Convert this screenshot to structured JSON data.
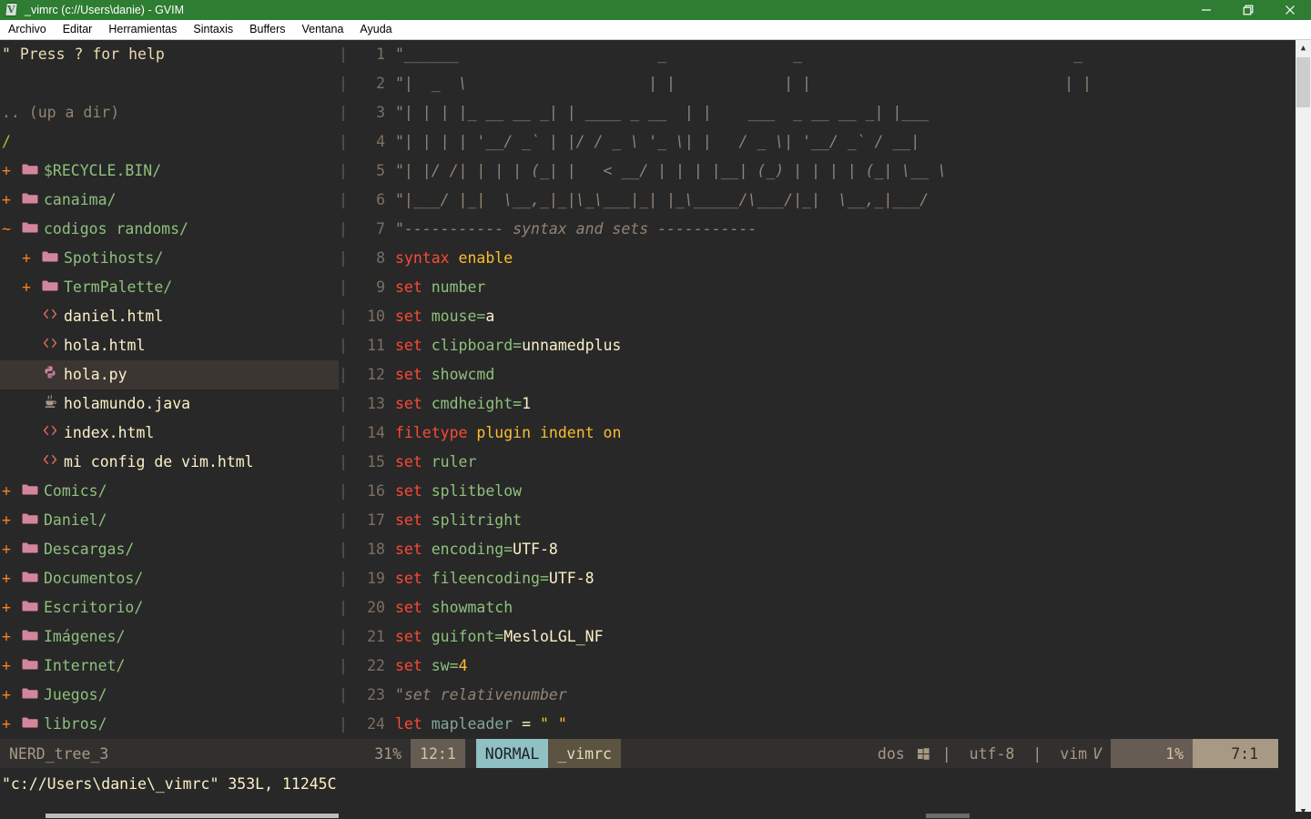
{
  "window": {
    "title": "_vimrc (c://Users\\danie) - GVIM",
    "icon": "gvim-icon",
    "controls": {
      "minimize": "minimize-icon",
      "restore": "restore-icon",
      "close": "close-icon"
    },
    "titlebar_color": "#2e7d32"
  },
  "menubar": {
    "items": [
      {
        "label": "Archivo"
      },
      {
        "label": "Editar"
      },
      {
        "label": "Herramientas"
      },
      {
        "label": "Sintaxis"
      },
      {
        "label": "Buffers"
      },
      {
        "label": "Ventana"
      },
      {
        "label": "Ayuda"
      }
    ]
  },
  "nerdtree": {
    "help_line": "\" Press ? for help",
    "blank_line": "",
    "up_dir": ".. (up a dir)",
    "root": "/",
    "rows": [
      {
        "marker": "+",
        "icon": "folder-icon",
        "kind": "dir",
        "indent": 0,
        "label": "$RECYCLE.BIN/"
      },
      {
        "marker": "+",
        "icon": "folder-icon",
        "kind": "dir",
        "indent": 0,
        "label": "canaima/"
      },
      {
        "marker": "~",
        "icon": "folder-icon",
        "kind": "dir",
        "indent": 0,
        "label": "codigos randoms/"
      },
      {
        "marker": "+",
        "icon": "folder-icon",
        "kind": "dir",
        "indent": 1,
        "label": "Spotihosts/"
      },
      {
        "marker": "+",
        "icon": "folder-icon",
        "kind": "dir",
        "indent": 1,
        "label": "TermPalette/"
      },
      {
        "marker": "",
        "icon": "html-file-icon",
        "kind": "file",
        "indent": 1,
        "label": "daniel.html"
      },
      {
        "marker": "",
        "icon": "html-file-icon",
        "kind": "file",
        "indent": 1,
        "label": "hola.html"
      },
      {
        "marker": "",
        "icon": "python-file-icon",
        "kind": "file",
        "indent": 1,
        "label": "hola.py",
        "selected": true
      },
      {
        "marker": "",
        "icon": "java-file-icon",
        "kind": "file",
        "indent": 1,
        "label": "holamundo.java"
      },
      {
        "marker": "",
        "icon": "html-file-icon",
        "kind": "file",
        "indent": 1,
        "label": "index.html"
      },
      {
        "marker": "",
        "icon": "html-file-icon",
        "kind": "file",
        "indent": 1,
        "label": "mi config de vim.html"
      },
      {
        "marker": "+",
        "icon": "folder-icon",
        "kind": "dir",
        "indent": 0,
        "label": "Comics/"
      },
      {
        "marker": "+",
        "icon": "folder-icon",
        "kind": "dir",
        "indent": 0,
        "label": "Daniel/"
      },
      {
        "marker": "+",
        "icon": "folder-icon",
        "kind": "dir",
        "indent": 0,
        "label": "Descargas/"
      },
      {
        "marker": "+",
        "icon": "folder-icon",
        "kind": "dir",
        "indent": 0,
        "label": "Documentos/"
      },
      {
        "marker": "+",
        "icon": "folder-icon",
        "kind": "dir",
        "indent": 0,
        "label": "Escritorio/"
      },
      {
        "marker": "+",
        "icon": "folder-icon",
        "kind": "dir",
        "indent": 0,
        "label": "Imágenes/"
      },
      {
        "marker": "+",
        "icon": "folder-icon",
        "kind": "dir",
        "indent": 0,
        "label": "Internet/"
      },
      {
        "marker": "+",
        "icon": "folder-icon",
        "kind": "dir",
        "indent": 0,
        "label": "Juegos/"
      },
      {
        "marker": "+",
        "icon": "folder-icon",
        "kind": "dir",
        "indent": 0,
        "label": "libros/"
      }
    ]
  },
  "editor": {
    "lines": [
      {
        "n": 1,
        "tokens": [
          {
            "t": "\"______                      _              _                              _",
            "c": "comment"
          }
        ]
      },
      {
        "n": 2,
        "tokens": [
          {
            "t": "\"|  _  \\                    | |            | |                            | |",
            "c": "comment"
          }
        ]
      },
      {
        "n": 3,
        "tokens": [
          {
            "t": "\"| | | |_ __ __ _| | ____ _ __  | |    ___  _ __ __ _| |___",
            "c": "comment"
          }
        ]
      },
      {
        "n": 4,
        "tokens": [
          {
            "t": "\"| | | | '__/ _` | |/ / _ \\ '_ \\| |   / _ \\| '__/ _` / __|",
            "c": "comment"
          }
        ]
      },
      {
        "n": 5,
        "tokens": [
          {
            "t": "\"| |/ /| | | | (_| |   < __/ | | | |__| (_) | | | | (_| \\__ \\",
            "c": "comment"
          }
        ]
      },
      {
        "n": 6,
        "tokens": [
          {
            "t": "\"|___/ |_|  \\__,_|_|\\_\\___|_| |_\\_____/\\___/|_|  \\__,_|___/",
            "c": "comment"
          }
        ]
      },
      {
        "n": 7,
        "tokens": [
          {
            "t": "\"----------- syntax and sets -----------",
            "c": "comment"
          }
        ]
      },
      {
        "n": 8,
        "tokens": [
          {
            "t": "syntax",
            "c": "cmd"
          },
          {
            "t": " ",
            "c": "op"
          },
          {
            "t": "enable",
            "c": "const"
          }
        ]
      },
      {
        "n": 9,
        "tokens": [
          {
            "t": "set",
            "c": "cmd"
          },
          {
            "t": " ",
            "c": "op"
          },
          {
            "t": "number",
            "c": "opt"
          }
        ]
      },
      {
        "n": 10,
        "tokens": [
          {
            "t": "set",
            "c": "cmd"
          },
          {
            "t": " ",
            "c": "op"
          },
          {
            "t": "mouse=",
            "c": "opt"
          },
          {
            "t": "a",
            "c": "val"
          }
        ]
      },
      {
        "n": 11,
        "tokens": [
          {
            "t": "set",
            "c": "cmd"
          },
          {
            "t": " ",
            "c": "op"
          },
          {
            "t": "clipboard=",
            "c": "opt"
          },
          {
            "t": "unnamedplus",
            "c": "val"
          }
        ]
      },
      {
        "n": 12,
        "tokens": [
          {
            "t": "set",
            "c": "cmd"
          },
          {
            "t": " ",
            "c": "op"
          },
          {
            "t": "showcmd",
            "c": "opt"
          }
        ]
      },
      {
        "n": 13,
        "tokens": [
          {
            "t": "set",
            "c": "cmd"
          },
          {
            "t": " ",
            "c": "op"
          },
          {
            "t": "cmdheight=",
            "c": "opt"
          },
          {
            "t": "1",
            "c": "val"
          }
        ]
      },
      {
        "n": 14,
        "tokens": [
          {
            "t": "filetype",
            "c": "cmd"
          },
          {
            "t": " ",
            "c": "op"
          },
          {
            "t": "plugin",
            "c": "const"
          },
          {
            "t": " ",
            "c": "op"
          },
          {
            "t": "indent",
            "c": "const"
          },
          {
            "t": " ",
            "c": "op"
          },
          {
            "t": "on",
            "c": "const"
          }
        ]
      },
      {
        "n": 15,
        "tokens": [
          {
            "t": "set",
            "c": "cmd"
          },
          {
            "t": " ",
            "c": "op"
          },
          {
            "t": "ruler",
            "c": "opt"
          }
        ]
      },
      {
        "n": 16,
        "tokens": [
          {
            "t": "set",
            "c": "cmd"
          },
          {
            "t": " ",
            "c": "op"
          },
          {
            "t": "splitbelow",
            "c": "opt"
          }
        ]
      },
      {
        "n": 17,
        "tokens": [
          {
            "t": "set",
            "c": "cmd"
          },
          {
            "t": " ",
            "c": "op"
          },
          {
            "t": "splitright",
            "c": "opt"
          }
        ]
      },
      {
        "n": 18,
        "tokens": [
          {
            "t": "set",
            "c": "cmd"
          },
          {
            "t": " ",
            "c": "op"
          },
          {
            "t": "encoding=",
            "c": "opt"
          },
          {
            "t": "UTF-8",
            "c": "val"
          }
        ]
      },
      {
        "n": 19,
        "tokens": [
          {
            "t": "set",
            "c": "cmd"
          },
          {
            "t": " ",
            "c": "op"
          },
          {
            "t": "fileencoding=",
            "c": "opt"
          },
          {
            "t": "UTF-8",
            "c": "val"
          }
        ]
      },
      {
        "n": 20,
        "tokens": [
          {
            "t": "set",
            "c": "cmd"
          },
          {
            "t": " ",
            "c": "op"
          },
          {
            "t": "showmatch",
            "c": "opt"
          }
        ]
      },
      {
        "n": 21,
        "tokens": [
          {
            "t": "set",
            "c": "cmd"
          },
          {
            "t": " ",
            "c": "op"
          },
          {
            "t": "guifont=",
            "c": "opt"
          },
          {
            "t": "MesloLGL_NF",
            "c": "val"
          }
        ]
      },
      {
        "n": 22,
        "tokens": [
          {
            "t": "set",
            "c": "cmd"
          },
          {
            "t": " ",
            "c": "op"
          },
          {
            "t": "sw=",
            "c": "opt"
          },
          {
            "t": "4",
            "c": "const"
          }
        ]
      },
      {
        "n": 23,
        "tokens": [
          {
            "t": "\"set relativenumber",
            "c": "comment"
          }
        ]
      },
      {
        "n": 24,
        "tokens": [
          {
            "t": "let",
            "c": "cmd"
          },
          {
            "t": " ",
            "c": "op"
          },
          {
            "t": "mapleader",
            "c": "ident"
          },
          {
            "t": " = ",
            "c": "op"
          },
          {
            "t": "\" \"",
            "c": "str"
          }
        ]
      }
    ]
  },
  "statusline": {
    "buffer_name": "NERD_tree_3",
    "percent_left": "31%",
    "position_left": "12:1",
    "mode": "NORMAL",
    "file": "_vimrc",
    "fileformat": "dos",
    "fileformat_icon": "windows-icon",
    "separator1": "|",
    "encoding": "utf-8",
    "separator2": "|",
    "filetype": "vim",
    "filetype_icon": "vim-icon",
    "percent_right": "1%",
    "position_right": "7:1",
    "mode_bg": "#8ec0c4"
  },
  "cmdline": {
    "message": "\"c://Users\\danie\\_vimrc\" 353L, 11245C"
  },
  "scrollbars": {
    "vertical_up": "scroll-up-arrow-icon",
    "vertical_down": "scroll-down-arrow-icon"
  }
}
